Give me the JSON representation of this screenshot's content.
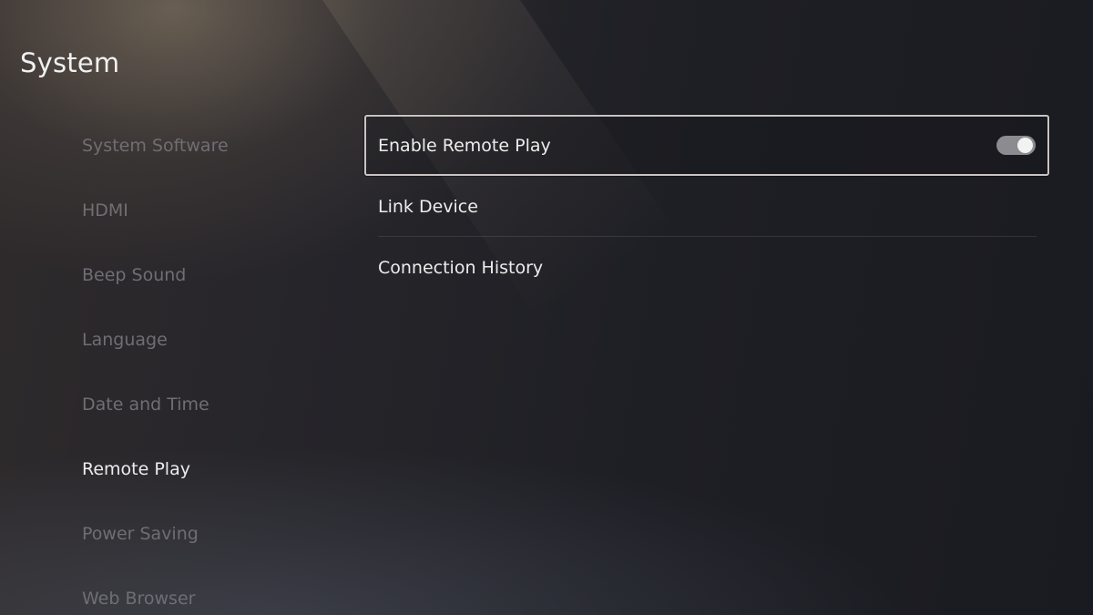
{
  "header": {
    "title": "System"
  },
  "sidebar": {
    "items": [
      {
        "label": "System Software"
      },
      {
        "label": "HDMI"
      },
      {
        "label": "Beep Sound"
      },
      {
        "label": "Language"
      },
      {
        "label": "Date and Time"
      },
      {
        "label": "Remote Play"
      },
      {
        "label": "Power Saving"
      },
      {
        "label": "Web Browser"
      }
    ],
    "selected": "Remote Play"
  },
  "content": {
    "rows": [
      {
        "label": "Enable Remote Play",
        "control": "toggle",
        "toggle_on": true
      },
      {
        "label": "Link Device"
      },
      {
        "label": "Connection History"
      }
    ]
  }
}
